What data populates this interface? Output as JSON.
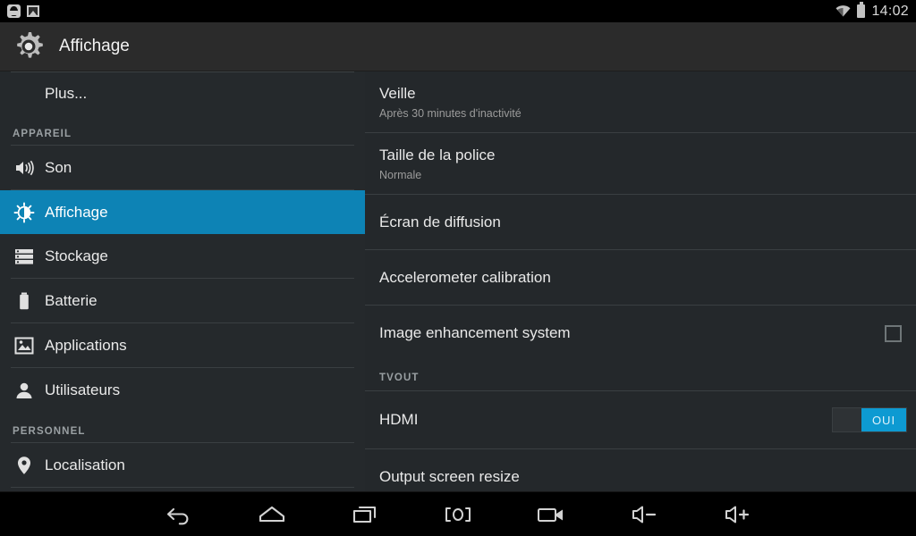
{
  "statusbar": {
    "notification_icons": [
      "app-notification-icon",
      "screenshot-icon"
    ],
    "wifi_icon": "wifi-icon",
    "battery_icon": "battery-icon",
    "clock": "14:02"
  },
  "actionbar": {
    "icon": "settings-gear-icon",
    "title": "Affichage"
  },
  "sidebar": {
    "items": [
      {
        "label": "Plus...",
        "icon": "",
        "selected": false,
        "indented": true
      },
      {
        "label": "Son",
        "icon": "sound-icon",
        "selected": false
      },
      {
        "label": "Affichage",
        "icon": "brightness-icon",
        "selected": true
      },
      {
        "label": "Stockage",
        "icon": "storage-icon",
        "selected": false
      },
      {
        "label": "Batterie",
        "icon": "battery-icon",
        "selected": false
      },
      {
        "label": "Applications",
        "icon": "applications-icon",
        "selected": false
      },
      {
        "label": "Utilisateurs",
        "icon": "user-icon",
        "selected": false
      },
      {
        "label": "Localisation",
        "icon": "location-pin-icon",
        "selected": false
      }
    ],
    "section_device": "APPAREIL",
    "section_personal": "PERSONNEL"
  },
  "content": {
    "rows": [
      {
        "title": "Veille",
        "subtitle": "Après 30 minutes d'inactivité",
        "control": "none"
      },
      {
        "title": "Taille de la police",
        "subtitle": "Normale",
        "control": "none"
      },
      {
        "title": "Écran de diffusion",
        "subtitle": "",
        "control": "none"
      },
      {
        "title": "Accelerometer calibration",
        "subtitle": "",
        "control": "none"
      },
      {
        "title": "Image enhancement system",
        "subtitle": "",
        "control": "checkbox",
        "checked": false
      }
    ],
    "section_tvout": "TVOUT",
    "tvout_rows": [
      {
        "title": "HDMI",
        "subtitle": "",
        "control": "switch",
        "switch_label": "OUI",
        "switch_on": true
      },
      {
        "title": "Output screen resize",
        "subtitle": "",
        "control": "none"
      }
    ]
  },
  "navbar": {
    "buttons": [
      {
        "name": "back-icon",
        "label": "Retour"
      },
      {
        "name": "home-icon",
        "label": "Accueil"
      },
      {
        "name": "recents-icon",
        "label": "Applications récentes"
      },
      {
        "name": "screenshot-icon",
        "label": "Capture d'écran"
      },
      {
        "name": "screen-record-icon",
        "label": "Enregistrement"
      },
      {
        "name": "volume-down-icon",
        "label": "Volume -"
      },
      {
        "name": "volume-up-icon",
        "label": "Volume +"
      }
    ]
  },
  "colors": {
    "accent_blue": "#0d83b5",
    "switch_blue": "#0d9ad2",
    "panel_bg": "#24282b",
    "actionbar_bg": "#2b2b2b",
    "statusbar_bg": "#000000"
  }
}
